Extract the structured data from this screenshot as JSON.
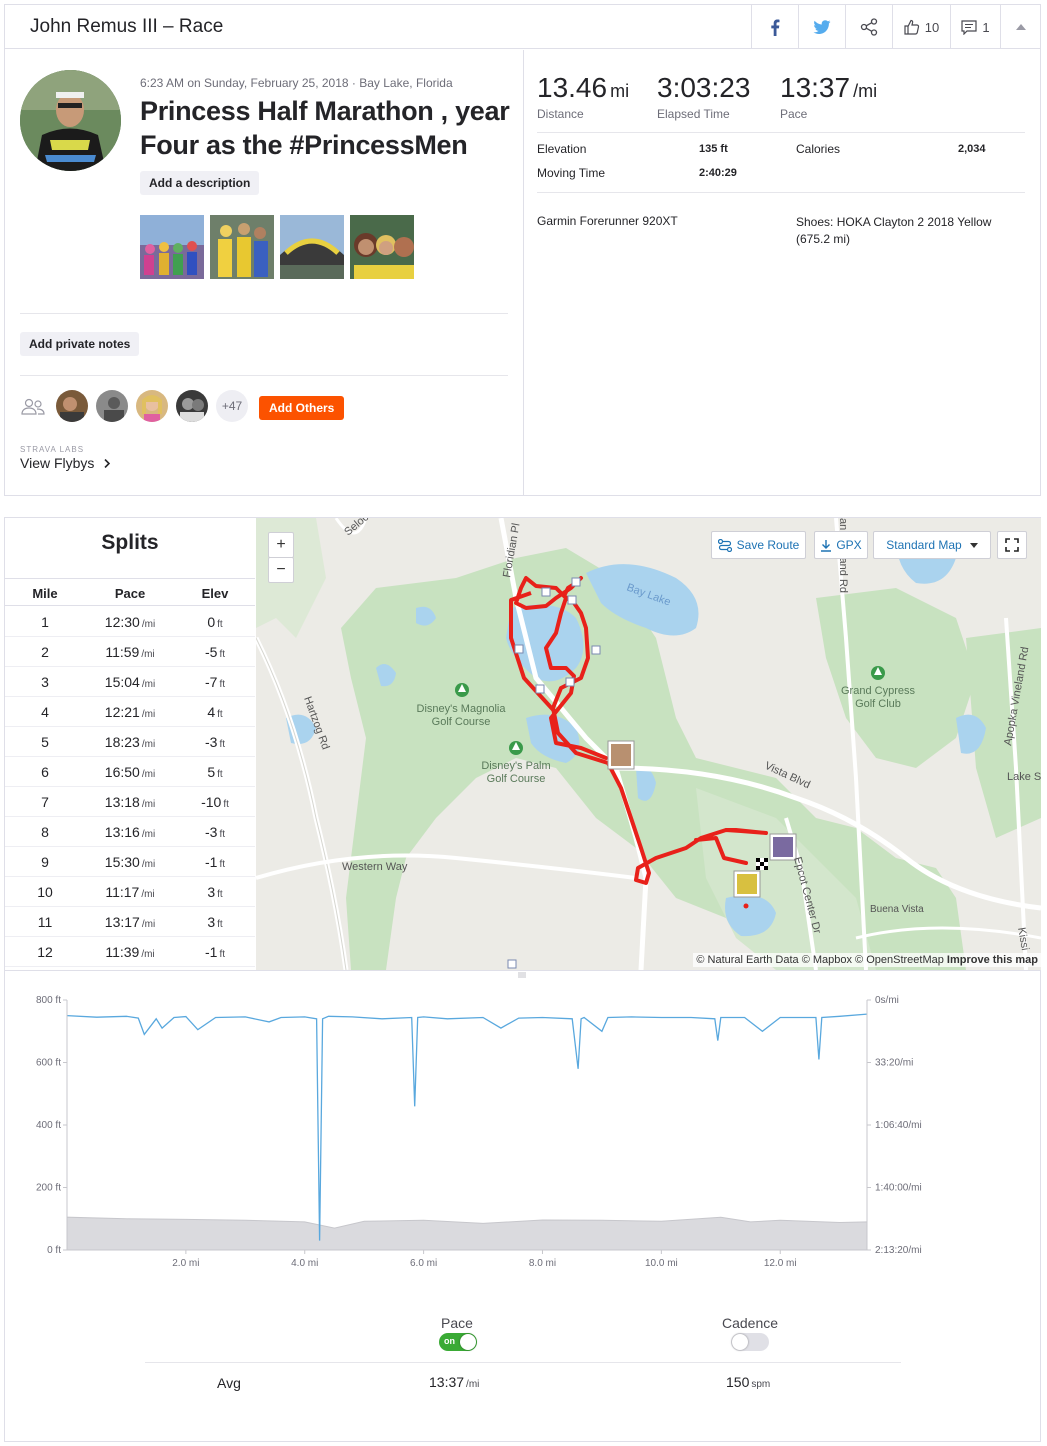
{
  "header": {
    "title": "John Remus III – Race",
    "kudos_count": "10",
    "comment_count": "1"
  },
  "activity": {
    "meta": "6:23 AM on Sunday, February 25, 2018 · Bay Lake, Florida",
    "title": "Princess Half Marathon , year Four as the #PrincessMen",
    "add_description_label": "Add a description",
    "add_private_notes_label": "Add private notes",
    "more_athletes": "+47",
    "add_others_label": "Add Others",
    "strava_labs_label": "STRAVA LABS",
    "view_flybys_label": "View Flybys"
  },
  "stats": {
    "distance_value": "13.46",
    "distance_unit": "mi",
    "distance_label": "Distance",
    "elapsed_value": "3:03:23",
    "elapsed_label": "Elapsed Time",
    "pace_value": "13:37",
    "pace_unit": "/mi",
    "pace_label": "Pace",
    "elevation_label": "Elevation",
    "elevation_value": "135 ft",
    "calories_label": "Calories",
    "calories_value": "2,034",
    "moving_time_label": "Moving Time",
    "moving_time_value": "2:40:29",
    "device": "Garmin Forerunner 920XT",
    "shoes": "Shoes: HOKA Clayton 2 2018 Yellow (675.2 mi)"
  },
  "splits": {
    "title": "Splits",
    "headers": [
      "Mile",
      "Pace",
      "Elev"
    ],
    "pace_unit": "/mi",
    "elev_unit": "ft",
    "rows": [
      {
        "mile": "1",
        "pace": "12:30",
        "elev": "0"
      },
      {
        "mile": "2",
        "pace": "11:59",
        "elev": "-5"
      },
      {
        "mile": "3",
        "pace": "15:04",
        "elev": "-7"
      },
      {
        "mile": "4",
        "pace": "12:21",
        "elev": "4"
      },
      {
        "mile": "5",
        "pace": "18:23",
        "elev": "-3"
      },
      {
        "mile": "6",
        "pace": "16:50",
        "elev": "5"
      },
      {
        "mile": "7",
        "pace": "13:18",
        "elev": "-10"
      },
      {
        "mile": "8",
        "pace": "13:16",
        "elev": "-3"
      },
      {
        "mile": "9",
        "pace": "15:30",
        "elev": "-1"
      },
      {
        "mile": "10",
        "pace": "11:17",
        "elev": "3"
      },
      {
        "mile": "11",
        "pace": "13:17",
        "elev": "3"
      },
      {
        "mile": "12",
        "pace": "11:39",
        "elev": "-1"
      }
    ]
  },
  "map": {
    "zoom_in": "+",
    "zoom_out": "−",
    "save_route_label": "Save Route",
    "gpx_label": "GPX",
    "map_type_label": "Standard Map",
    "attribution": "© Natural Earth Data © Mapbox © OpenStreetMap",
    "improve_label": "Improve this map",
    "labels": {
      "bay_lake": "Bay Lake",
      "magnolia": "Disney's Magnolia Golf Course",
      "palm": "Disney's Palm Golf Course",
      "grand_cypress": "Grand Cypress Golf Club",
      "hartzog": "Hartzog Rd",
      "floridian": "Floridian Pl",
      "western_way": "Western Way",
      "vista_blvd": "Vista Blvd",
      "epcot": "Epcot Center Dr",
      "buena_vista": "Buena Vista",
      "apopka": "Apopka Vineland Rd",
      "vineland": "an Vineland Rd",
      "lake_st": "Lake St",
      "seloc": "Seloc",
      "kissi": "Kissi"
    },
    "route_color": "#e8211a"
  },
  "chart_data": {
    "type": "line",
    "xlabel": "",
    "x_ticks": [
      "2.0 mi",
      "4.0 mi",
      "6.0 mi",
      "8.0 mi",
      "10.0 mi",
      "12.0 mi"
    ],
    "x_tick_values": [
      2,
      4,
      6,
      8,
      10,
      12
    ],
    "xlim": [
      0,
      13.46
    ],
    "left_axis": {
      "ticks": [
        "800 ft",
        "600 ft",
        "400 ft",
        "200 ft",
        "0 ft"
      ],
      "ylim": [
        0,
        800
      ]
    },
    "right_axis": {
      "ticks": [
        "0s/mi",
        "33:20/mi",
        "1:06:40/mi",
        "1:40:00/mi",
        "2:13:20/mi"
      ],
      "ylim_sec": [
        0,
        8000
      ]
    },
    "series": [
      {
        "name": "Pace",
        "color": "#59a8de",
        "x": [
          0,
          0.5,
          1,
          1.2,
          1.3,
          1.5,
          1.6,
          1.8,
          2.0,
          2.2,
          2.5,
          3.0,
          3.4,
          3.6,
          4.0,
          4.2,
          4.25,
          4.3,
          4.4,
          4.8,
          5.3,
          5.8,
          5.85,
          5.9,
          6.0,
          6.4,
          7.0,
          7.3,
          7.6,
          8.0,
          8.5,
          8.6,
          8.65,
          8.7,
          9.0,
          9.1,
          9.5,
          10.0,
          10.5,
          10.9,
          10.95,
          11.0,
          11.4,
          11.7,
          12.0,
          12.6,
          12.65,
          12.7,
          13.0,
          13.46
        ],
        "pace_sec": [
          500,
          550,
          520,
          580,
          1100,
          600,
          900,
          560,
          530,
          950,
          560,
          540,
          700,
          560,
          540,
          600,
          7700,
          600,
          520,
          540,
          600,
          560,
          3400,
          560,
          540,
          600,
          560,
          900,
          580,
          560,
          600,
          2200,
          600,
          560,
          1000,
          560,
          540,
          560,
          560,
          600,
          1300,
          560,
          560,
          1000,
          560,
          560,
          1900,
          560,
          520,
          450
        ]
      },
      {
        "name": "Elevation",
        "color": "#c7c7cc",
        "x": [
          0,
          1,
          2,
          3,
          4,
          4.5,
          5,
          6,
          7,
          8,
          9,
          10,
          11,
          11.5,
          12,
          13,
          13.46
        ],
        "elev_ft": [
          105,
          100,
          98,
          95,
          90,
          70,
          92,
          95,
          85,
          96,
          95,
          92,
          105,
          90,
          95,
          88,
          90
        ]
      }
    ]
  },
  "analysis": {
    "pace_label": "Pace",
    "pace_toggle_text": "on",
    "cadence_label": "Cadence",
    "avg_label": "Avg",
    "avg_pace": "13:37",
    "avg_pace_unit": "/mi",
    "avg_cadence": "150",
    "avg_cadence_unit": "spm"
  }
}
